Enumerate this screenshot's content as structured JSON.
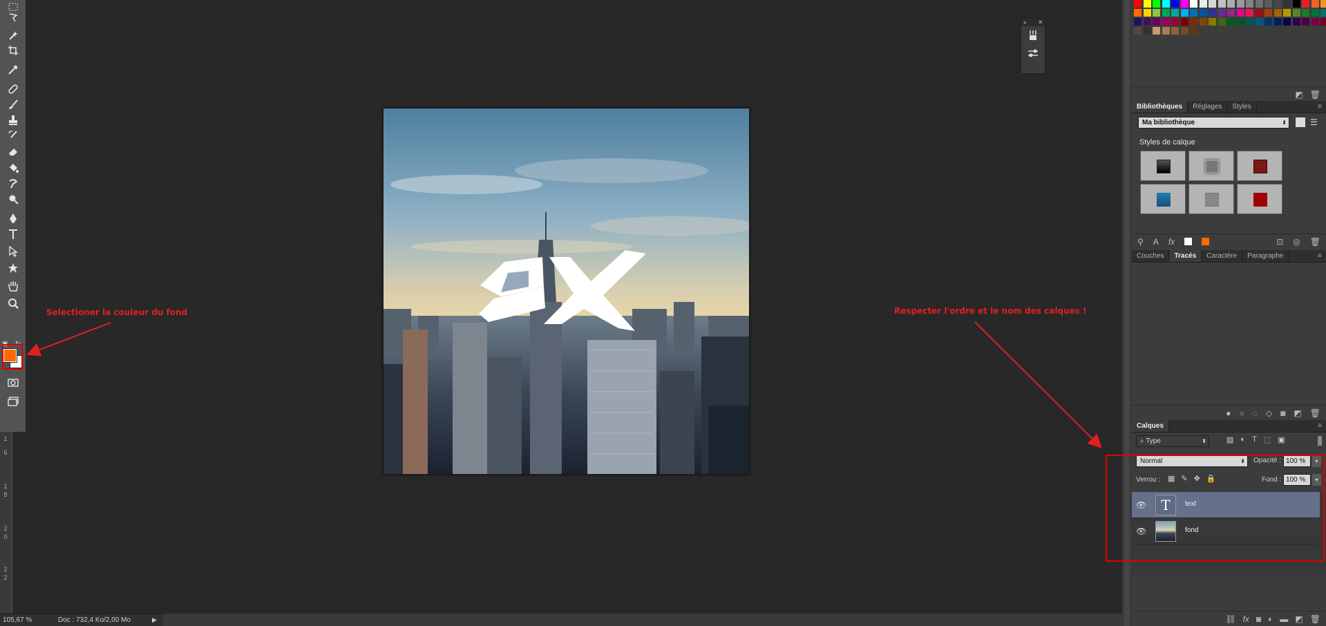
{
  "toolbar": {
    "tools": [
      "marquee-icon",
      "lasso-icon",
      "magic-wand-icon",
      "crop-icon",
      "eyedropper-icon",
      "healing-brush-icon",
      "brush-icon",
      "clone-stamp-icon",
      "history-brush-icon",
      "eraser-icon",
      "paint-bucket-icon",
      "smudge-icon",
      "dodge-icon",
      "pen-icon",
      "type-icon",
      "path-selection-icon",
      "shape-icon",
      "hand-icon",
      "zoom-icon"
    ],
    "foreground_color": "#ff6a00",
    "background_color": "#ffffff"
  },
  "ruler": {
    "ticks": [
      "1",
      "6",
      "1",
      "8",
      "2",
      "0",
      "2",
      "2"
    ]
  },
  "canvas": {
    "logo_text": "OX"
  },
  "annotations": {
    "left": "Selectioner la couleur du fond",
    "right": "Respecter l'ordre et le nom des calques !",
    "color": "#e21f1f"
  },
  "libraries_panel": {
    "tabs": [
      "Bibliothèques",
      "Réglages",
      "Styles"
    ],
    "active_tab": "Bibliothèques",
    "library_select": "Ma bibliothèque",
    "section_title": "Styles de calque"
  },
  "paths_panel": {
    "tabs": [
      "Couches",
      "Tracés",
      "Caractère",
      "Paragraphe"
    ],
    "active_tab": "Tracés"
  },
  "layers_panel": {
    "tab": "Calques",
    "filter": "Type",
    "blend_mode": "Normal",
    "opacity_label": "Opacité :",
    "opacity_value": "100 %",
    "lock_label": "Verrou :",
    "fill_label": "Fond :",
    "fill_value": "100 %",
    "layers": [
      {
        "name": "text",
        "kind": "type",
        "selected": true
      },
      {
        "name": "fond",
        "kind": "image",
        "selected": false
      }
    ]
  },
  "status": {
    "zoom": "105,67 %",
    "doc": "Doc : 732,4 Ko/2,00 Mo"
  }
}
